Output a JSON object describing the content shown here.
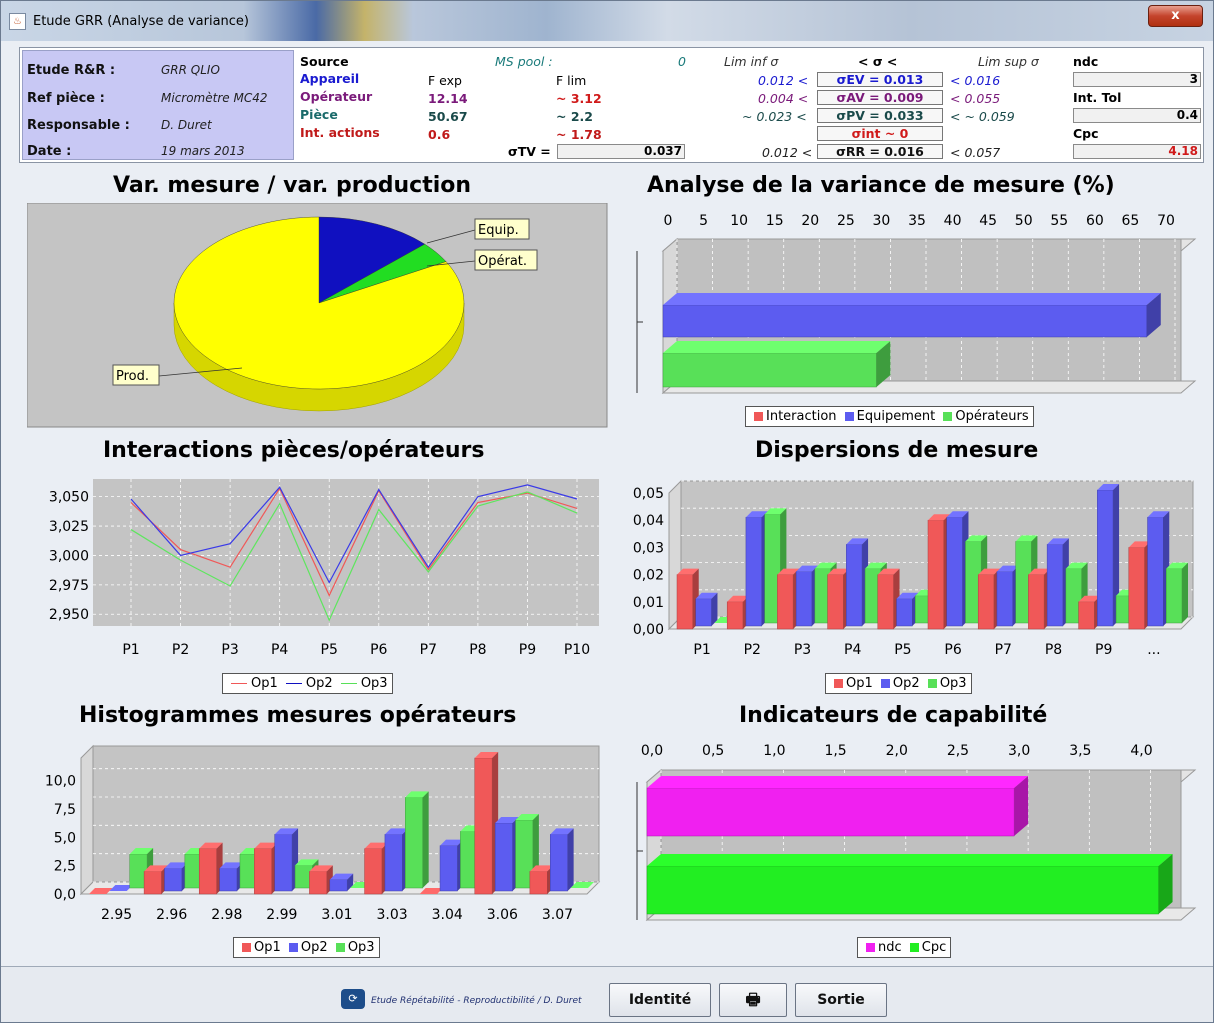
{
  "window": {
    "title": "Etude GRR (Analyse de variance)",
    "close": "x"
  },
  "identity": {
    "labels": [
      "Etude R&R :",
      "Ref pièce :",
      "Responsable :",
      "Date :"
    ],
    "values": [
      "GRR QLIO",
      "Micromètre MC42",
      "D. Duret",
      "19 mars 2013"
    ]
  },
  "stats": {
    "source": "Source",
    "ms_pool": "MS pool :",
    "ms_pool_val": "0",
    "lim_inf": "Lim inf σ",
    "sigma_hdr": "< σ <",
    "lim_sup": "Lim sup σ",
    "appareil": "Appareil",
    "operateur": "Opérateur",
    "piece": "Pièce",
    "int_actions": "Int. actions",
    "fexp_hdr": "F exp",
    "flim_hdr": "F lim",
    "fexp": [
      "12.14",
      "50.67",
      "0.6"
    ],
    "flim": [
      "~ 3.12",
      "~ 2.2",
      "~ 1.78"
    ],
    "sigma_tv_label": "σTV =",
    "sigma_tv": "0.037",
    "inf": [
      "0.012 <",
      "0.004 <",
      "~ 0.023 <",
      "0.012 <"
    ],
    "sig": [
      "σEV = 0.013",
      "σAV = 0.009",
      "σPV = 0.033",
      "σint ~ 0",
      "σRR = 0.016"
    ],
    "sup": [
      "< 0.016",
      "< 0.055",
      "< ~ 0.059",
      "< 0.057"
    ],
    "ndc_label": "ndc",
    "ndc": "3",
    "inttol_label": "Int. Tol",
    "inttol": "0.4",
    "cpc_label": "Cpc",
    "cpc": "4.18"
  },
  "titles": {
    "pie": "Var. mesure / var. production",
    "anova": "Analyse de la variance de mesure (%)",
    "inter": "Interactions pièces/opérateurs",
    "disp": "Dispersions de mesure",
    "hist": "Histogrammes mesures opérateurs",
    "cap": "Indicateurs de capabilité"
  },
  "colors": {
    "red": "#f05858",
    "blue": "#5c5cf0",
    "green": "#58e058",
    "magenta": "#f020f0",
    "yellow": "#ffff00",
    "navy": "#1010c0"
  },
  "chart_data": [
    {
      "type": "pie",
      "title": "Var. mesure / var. production",
      "labels": [
        "Equip.",
        "Opérat.",
        "Prod."
      ],
      "values": [
        13,
        4,
        83
      ]
    },
    {
      "type": "bar",
      "title": "Analyse de la variance de mesure (%)",
      "orientation": "horizontal",
      "xlim": [
        0,
        70
      ],
      "ticks": [
        "0",
        "5",
        "10",
        "15",
        "20",
        "25",
        "30",
        "35",
        "40",
        "45",
        "50",
        "55",
        "60",
        "65",
        "70"
      ],
      "series": [
        {
          "name": "Interaction",
          "values": [
            0
          ]
        },
        {
          "name": "Equipement",
          "values": [
            68
          ]
        },
        {
          "name": "Opérateurs",
          "values": [
            30
          ]
        }
      ]
    },
    {
      "type": "line",
      "title": "Interactions pièces/opérateurs",
      "categories": [
        "P1",
        "P2",
        "P3",
        "P4",
        "P5",
        "P6",
        "P7",
        "P8",
        "P9",
        "P10"
      ],
      "ylim": [
        2.94,
        3.065
      ],
      "yticks": [
        "3,050",
        "3,025",
        "3,000",
        "2,975",
        "2,950"
      ],
      "series": [
        {
          "name": "Op1",
          "values": [
            3.045,
            3.005,
            2.99,
            3.057,
            2.966,
            3.055,
            2.988,
            3.045,
            3.053,
            3.04
          ]
        },
        {
          "name": "Op2",
          "values": [
            3.048,
            3.0,
            3.01,
            3.058,
            2.977,
            3.056,
            2.99,
            3.05,
            3.06,
            3.048
          ]
        },
        {
          "name": "Op3",
          "values": [
            3.022,
            2.996,
            2.974,
            3.044,
            2.945,
            3.039,
            2.986,
            3.042,
            3.054,
            3.036
          ]
        }
      ]
    },
    {
      "type": "bar",
      "title": "Dispersions de mesure",
      "categories": [
        "P1",
        "P2",
        "P3",
        "P4",
        "P5",
        "P6",
        "P7",
        "P8",
        "P9",
        "..."
      ],
      "ylim": [
        0,
        0.05
      ],
      "yticks": [
        "0,05",
        "0,04",
        "0,03",
        "0,02",
        "0,01",
        "0,00"
      ],
      "series": [
        {
          "name": "Op1",
          "values": [
            0.02,
            0.01,
            0.02,
            0.02,
            0.02,
            0.04,
            0.02,
            0.02,
            0.01,
            0.03
          ]
        },
        {
          "name": "Op2",
          "values": [
            0.01,
            0.04,
            0.02,
            0.03,
            0.01,
            0.04,
            0.02,
            0.03,
            0.05,
            0.04
          ]
        },
        {
          "name": "Op3",
          "values": [
            0,
            0.04,
            0.02,
            0.02,
            0.01,
            0.03,
            0.03,
            0.02,
            0.01,
            0.02
          ]
        }
      ]
    },
    {
      "type": "bar",
      "title": "Histogrammes mesures opérateurs",
      "categories": [
        "2.95",
        "2.96",
        "2.98",
        "2.99",
        "3.01",
        "3.03",
        "3.04",
        "3.06",
        "3.07"
      ],
      "ylim": [
        0,
        12
      ],
      "yticks": [
        "10,0",
        "7,5",
        "5,0",
        "2,5",
        "0,0"
      ],
      "series": [
        {
          "name": "Op1",
          "values": [
            0,
            2,
            4,
            4,
            2,
            4,
            0,
            12,
            2
          ]
        },
        {
          "name": "Op2",
          "values": [
            0,
            2,
            2,
            5,
            1,
            5,
            4,
            6,
            5
          ]
        },
        {
          "name": "Op3",
          "values": [
            3,
            3,
            3,
            2,
            0,
            8,
            5,
            6,
            0
          ]
        }
      ]
    },
    {
      "type": "bar",
      "title": "Indicateurs de capabilité",
      "orientation": "horizontal",
      "xlim": [
        0,
        4.2
      ],
      "ticks": [
        "0,0",
        "0,5",
        "1,0",
        "1,5",
        "2,0",
        "2,5",
        "3,0",
        "3,5",
        "4,0"
      ],
      "series": [
        {
          "name": "ndc",
          "values": [
            3
          ]
        },
        {
          "name": "Cpc",
          "values": [
            4.18
          ]
        }
      ]
    }
  ],
  "legends": {
    "anova": [
      "Interaction",
      "Equipement",
      "Opérateurs"
    ],
    "ops": [
      "Op1",
      "Op2",
      "Op3"
    ],
    "cap": [
      "ndc",
      "Cpc"
    ]
  },
  "bottom": {
    "credit": "Etude Répétabilité - Reproductibilité / D. Duret",
    "identite": "Identité",
    "print_icon": "printer-icon",
    "sortie": "Sortie"
  }
}
